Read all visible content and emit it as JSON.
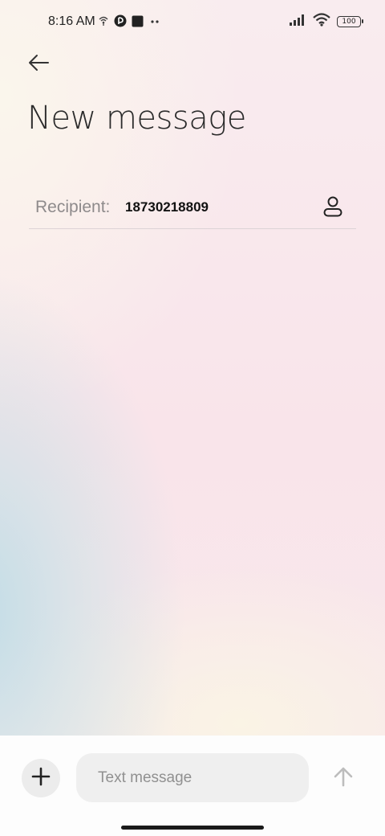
{
  "status_bar": {
    "time": "8:16 AM",
    "battery": "100",
    "icons": [
      "hotspot-icon",
      "app-notification-icon",
      "square-notification-icon",
      "more-dots-icon",
      "signal-icon",
      "wifi-icon",
      "battery-icon"
    ]
  },
  "header": {
    "back_icon": "back-arrow-icon",
    "title": "New message"
  },
  "recipient": {
    "label": "Recipient:",
    "value": "18730218809",
    "contact_icon": "person-icon"
  },
  "composer": {
    "add_icon": "plus-icon",
    "placeholder": "Text message",
    "value": "",
    "send_icon": "arrow-up-icon"
  }
}
